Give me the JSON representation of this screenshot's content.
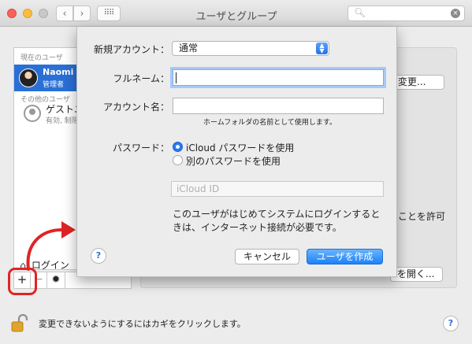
{
  "window": {
    "title": "ユーザとグループ",
    "nav_back": "‹",
    "nav_forward": "›",
    "grid": "⠿⠿",
    "search_placeholder": "",
    "search_icon": "search-icon",
    "clear_glyph": "×"
  },
  "sidebar": {
    "current_header": "現在のユーザ",
    "current_user_name": "Naomi S",
    "current_user_role": "管理者",
    "other_header": "その他のユーザ",
    "guest_name": "ゲストユ",
    "guest_sub": "有効, 制限",
    "login_label": "ログイン",
    "plus": "+",
    "minus": "−",
    "gear": "✹"
  },
  "pane": {
    "change_button": "変更...",
    "allow_text": "ことを許可",
    "open_button": "を開く..."
  },
  "bottom": {
    "lock_text": "変更できないようにするにはカギをクリックします。",
    "help": "?"
  },
  "sheet": {
    "new_account_label": "新規アカウント：",
    "account_type": "通常",
    "fullname_label": "フルネーム：",
    "fullname_value": "",
    "account_name_label": "アカウント名：",
    "account_name_value": "",
    "account_name_hint": "ホームフォルダの名前として使用します。",
    "password_label": "パスワード：",
    "radio_icloud": "iCloud パスワードを使用",
    "radio_other": "別のパスワードを使用",
    "icloud_placeholder": "iCloud ID",
    "note": "このユーザがはじめてシステムにログインするときは、インターネット接続が必要です。",
    "help": "?",
    "cancel_button": "キャンセル",
    "create_button": "ユーザを作成"
  },
  "colors": {
    "accent": "#2a78f0",
    "highlight": "#e02424",
    "selection": "#2a6fd6"
  }
}
